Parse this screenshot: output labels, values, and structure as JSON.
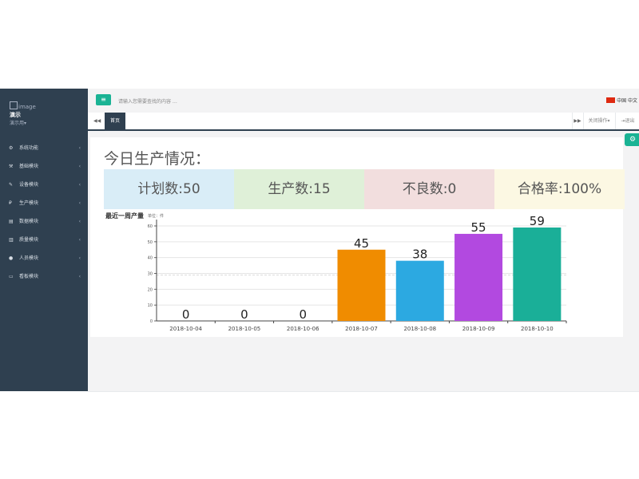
{
  "sidebar": {
    "image_alt": "image",
    "user_name": "演示",
    "user_role": "演示用",
    "items": [
      {
        "label": "系统功能",
        "icon": "gear-icon",
        "glyph": "⚙"
      },
      {
        "label": "基础模块",
        "icon": "wrench-icon",
        "glyph": "⚒"
      },
      {
        "label": "设备模块",
        "icon": "wrench-icon",
        "glyph": "✎"
      },
      {
        "label": "生产模块",
        "icon": "product-icon",
        "glyph": "₽"
      },
      {
        "label": "数据模块",
        "icon": "file-icon",
        "glyph": "▤"
      },
      {
        "label": "质量模块",
        "icon": "chart-icon",
        "glyph": "▥"
      },
      {
        "label": "人员模块",
        "icon": "user-icon",
        "glyph": "●"
      },
      {
        "label": "看板模块",
        "icon": "monitor-icon",
        "glyph": "▭"
      }
    ]
  },
  "topbar": {
    "search_placeholder": "请输入您需要查找的内容 …",
    "language": "中国 中文"
  },
  "tabs": {
    "home": "首页",
    "close_ops": "关闭操作",
    "exit": "退出"
  },
  "page": {
    "title": "今日生产情况："
  },
  "stats": [
    {
      "label": "计划数:50",
      "bg": "#d9edf7"
    },
    {
      "label": "生产数:15",
      "bg": "#dff0d8"
    },
    {
      "label": "不良数:0",
      "bg": "#f2dede"
    },
    {
      "label": "合格率:100%",
      "bg": "#fcf8e3"
    }
  ],
  "colors": {
    "accent": "#1ab394",
    "sidebar": "#2f4050"
  },
  "chart_data": {
    "type": "bar",
    "title": "最近一周产量",
    "ylabel": "单位：件",
    "categories": [
      "2018-10-04",
      "2018-10-05",
      "2018-10-06",
      "2018-10-07",
      "2018-10-08",
      "2018-10-09",
      "2018-10-10"
    ],
    "values": [
      0,
      0,
      0,
      45,
      38,
      55,
      59
    ],
    "colors": [
      "#f39c12",
      "#f39c12",
      "#f39c12",
      "#f08c00",
      "#2ca9e1",
      "#b249e0",
      "#1aaf98"
    ],
    "ylim": [
      0,
      60
    ],
    "yticks": [
      0,
      10,
      20,
      30,
      40,
      50,
      60
    ],
    "grid": true
  }
}
